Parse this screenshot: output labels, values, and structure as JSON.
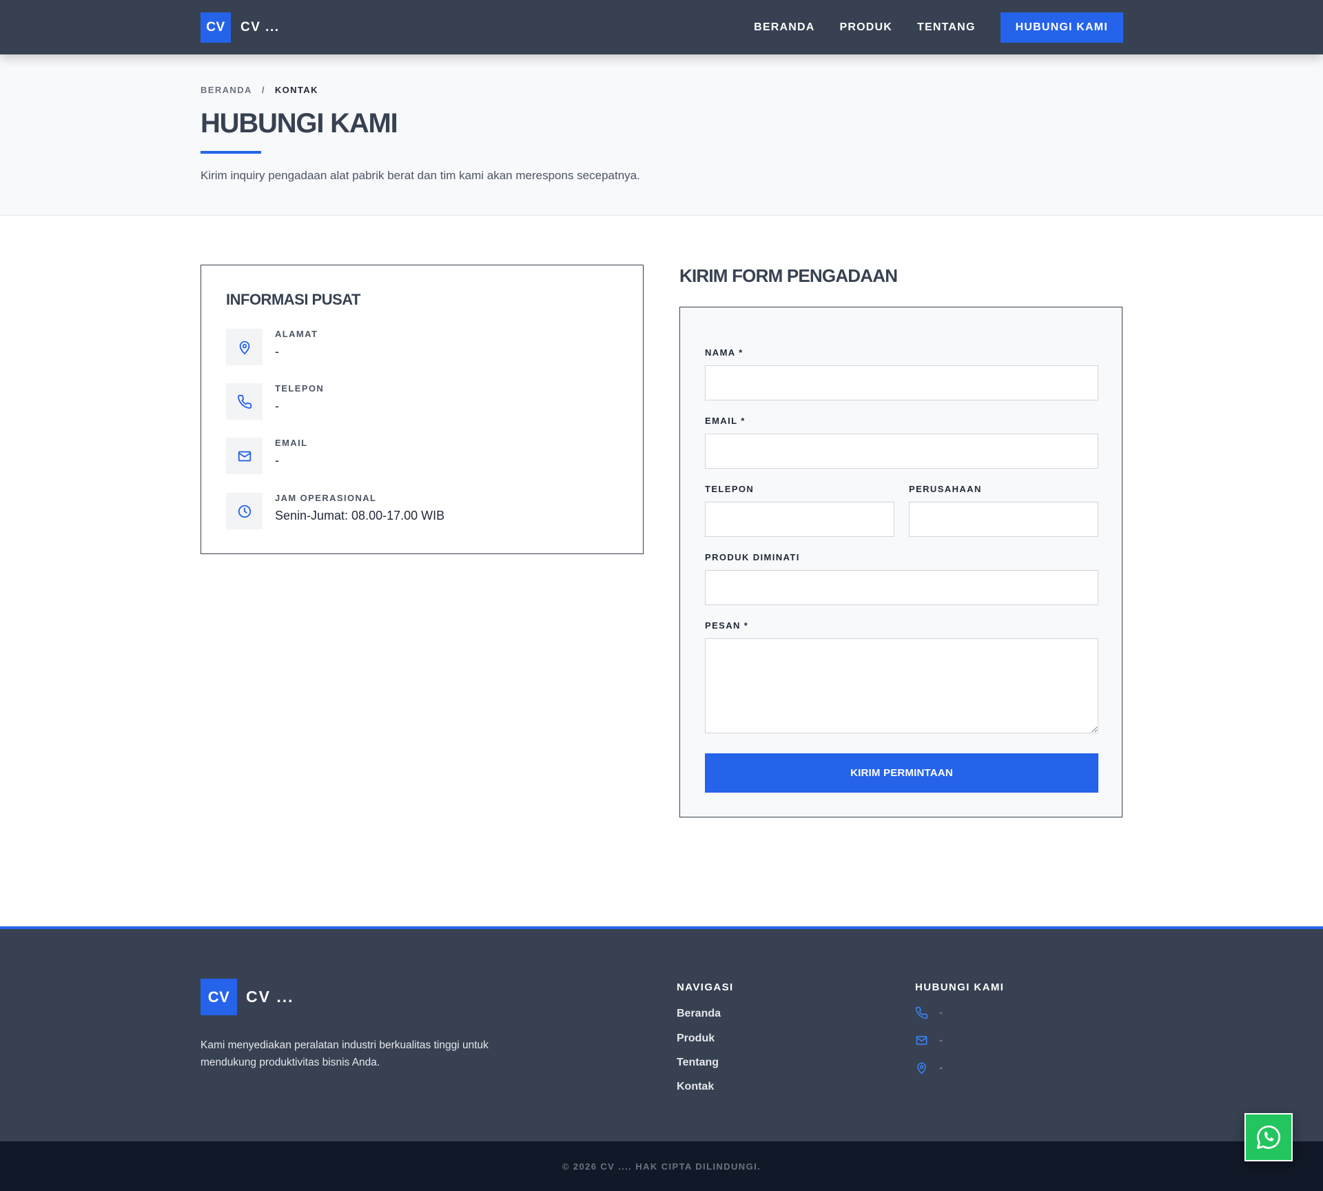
{
  "brand": {
    "logo_mark": "CV",
    "name": "CV ..."
  },
  "nav": {
    "items": [
      {
        "label": "BERANDA"
      },
      {
        "label": "PRODUK"
      },
      {
        "label": "TENTANG"
      }
    ],
    "cta_label": "HUBUNGI KAMI"
  },
  "hero": {
    "breadcrumb": {
      "home": "BERANDA",
      "separator": "/",
      "current": "KONTAK"
    },
    "title": "HUBUNGI KAMI",
    "subtitle": "Kirim inquiry pengadaan alat pabrik berat dan tim kami akan merespons secepatnya."
  },
  "info": {
    "title": "INFORMASI PUSAT",
    "items": [
      {
        "icon": "map-pin-icon",
        "label": "ALAMAT",
        "value": "-"
      },
      {
        "icon": "phone-icon",
        "label": "TELEPON",
        "value": "-"
      },
      {
        "icon": "mail-icon",
        "label": "EMAIL",
        "value": "-"
      },
      {
        "icon": "clock-icon",
        "label": "JAM OPERASIONAL",
        "value": "Senin-Jumat: 08.00-17.00 WIB"
      }
    ]
  },
  "form": {
    "title": "KIRIM FORM PENGADAAN",
    "fields": {
      "nama": {
        "label": "NAMA *",
        "value": ""
      },
      "email": {
        "label": "EMAIL *",
        "value": ""
      },
      "telepon": {
        "label": "TELEPON",
        "value": ""
      },
      "perusahaan": {
        "label": "PERUSAHAAN",
        "value": ""
      },
      "produk": {
        "label": "PRODUK DIMINATI",
        "value": ""
      },
      "pesan": {
        "label": "PESAN *",
        "value": ""
      }
    },
    "submit_label": "KIRIM PERMINTAAN"
  },
  "footer": {
    "description": "Kami menyediakan peralatan industri berkualitas tinggi untuk mendukung produktivitas bisnis Anda.",
    "nav_title": "NAVIGASI",
    "links": [
      {
        "label": "Beranda"
      },
      {
        "label": "Produk"
      },
      {
        "label": "Tentang"
      },
      {
        "label": "Kontak"
      }
    ],
    "contact_title": "HUBUNGI KAMI",
    "contacts": [
      {
        "icon": "phone-icon",
        "value": "-"
      },
      {
        "icon": "mail-icon",
        "value": "-"
      },
      {
        "icon": "map-pin-icon",
        "value": "-"
      }
    ],
    "copyright": "© 2026 CV .... HAK CIPTA DILINDUNGI."
  },
  "colors": {
    "accent": "#2563eb",
    "header_bg": "#374151",
    "footer_bottom_bg": "#111827",
    "whatsapp": "#22c55e"
  },
  "floating": {
    "icon": "whatsapp-icon"
  }
}
